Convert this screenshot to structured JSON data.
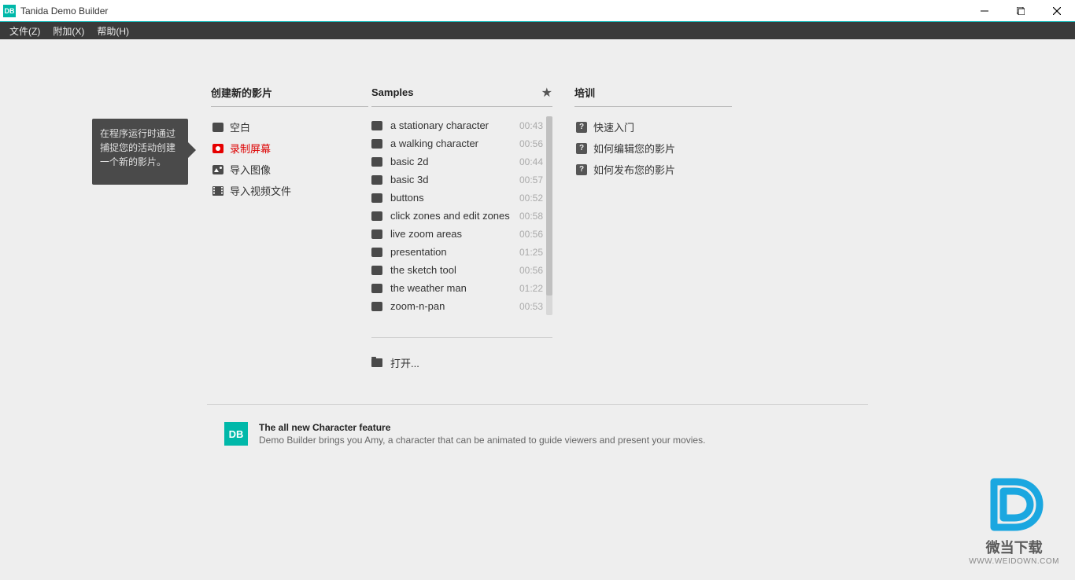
{
  "app": {
    "title": "Tanida Demo Builder",
    "icon_text": "DB"
  },
  "menubar": {
    "items": [
      "文件(Z)",
      "附加(X)",
      "帮助(H)"
    ]
  },
  "tooltip": "在程序运行时通过捕捉您的活动创建一个新的影片。",
  "columns": {
    "create": {
      "title": "创建新的影片",
      "items": [
        {
          "label": "空白",
          "icon": "box"
        },
        {
          "label": "录制屏幕",
          "icon": "rec",
          "selected": true
        },
        {
          "label": "导入图像",
          "icon": "img"
        },
        {
          "label": "导入视频文件",
          "icon": "film"
        }
      ]
    },
    "samples": {
      "title": "Samples",
      "items": [
        {
          "label": "a stationary character",
          "time": "00:43"
        },
        {
          "label": "a walking character",
          "time": "00:56"
        },
        {
          "label": "basic 2d",
          "time": "00:44"
        },
        {
          "label": "basic 3d",
          "time": "00:57"
        },
        {
          "label": "buttons",
          "time": "00:52"
        },
        {
          "label": "click zones and edit zones",
          "time": "00:58"
        },
        {
          "label": "live zoom areas",
          "time": "00:56"
        },
        {
          "label": "presentation",
          "time": "01:25"
        },
        {
          "label": "the sketch tool",
          "time": "00:56"
        },
        {
          "label": "the weather man",
          "time": "01:22"
        },
        {
          "label": "zoom-n-pan",
          "time": "00:53"
        }
      ],
      "open_label": "打开..."
    },
    "train": {
      "title": "培训",
      "items": [
        "快速入门",
        "如何编辑您的影片",
        "如何发布您的影片"
      ]
    }
  },
  "feature": {
    "logo": "DB",
    "title": "The all new Character feature",
    "desc": "Demo Builder brings you Amy, a character that can be animated to guide viewers and present your movies."
  },
  "watermark": {
    "line1": "微当下载",
    "line2": "WWW.WEIDOWN.COM"
  }
}
